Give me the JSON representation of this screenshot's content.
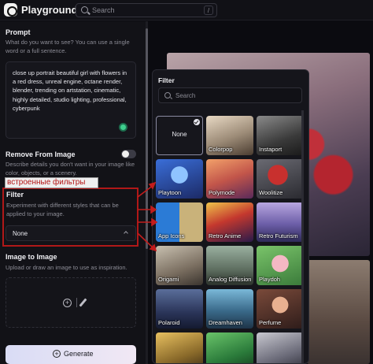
{
  "topbar": {
    "brand": "Playground",
    "search_placeholder": "Search",
    "search_shortcut": "/"
  },
  "left_panel": {
    "prompt_heading": "Prompt",
    "prompt_hint": "What do you want to see? You can use a single word or a full sentence.",
    "prompt_text": "close up portrait beautiful girl with flowers in a red dress, unreal engine, octane render, blender, trending on artstation, cinematic, highly detailed, studio lighting, professional, cyberpunk",
    "remove_heading": "Remove From Image",
    "remove_hint": "Describe details you don't want in your image like color, objects, or a scenery.",
    "annotation_label": "встроенные фильтры",
    "filter_heading": "Filter",
    "filter_hint": "Experiment with different styles that can be applied to your image.",
    "filter_value": "None",
    "image_heading": "Image to Image",
    "image_hint": "Upload or draw an image to use as inspiration.",
    "generate_label": "Generate"
  },
  "filter_popover": {
    "title": "Filter",
    "search_placeholder": "Search",
    "tiles": [
      {
        "label": "None",
        "selected": true
      },
      {
        "label": "Colorpop"
      },
      {
        "label": "Instaport"
      },
      {
        "label": "Playtoon"
      },
      {
        "label": "Polymode"
      },
      {
        "label": "Woolitize"
      },
      {
        "label": "App Icons"
      },
      {
        "label": "Retro Anime"
      },
      {
        "label": "Retro Futurism"
      },
      {
        "label": "Origami"
      },
      {
        "label": "Analog Diffusion"
      },
      {
        "label": "Playdoh"
      },
      {
        "label": "Polaroid"
      },
      {
        "label": "Dreamhaven"
      },
      {
        "label": "Perfume"
      },
      {
        "label": ""
      },
      {
        "label": ""
      },
      {
        "label": ""
      }
    ]
  },
  "colors": {
    "accent_red": "#b01818",
    "toggle_green": "#3fcf8e",
    "generate_bg": "#e4e2f5"
  }
}
